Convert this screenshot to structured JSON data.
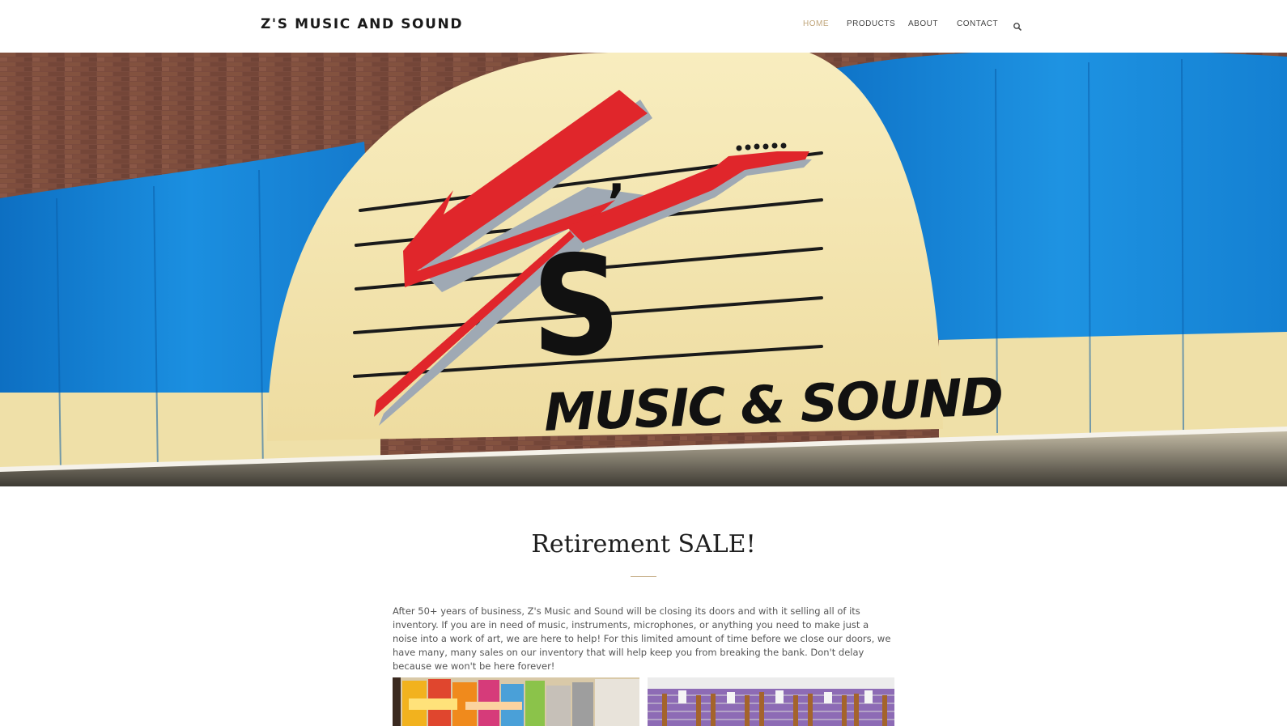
{
  "header": {
    "brand": "Z'S MUSIC AND SOUND",
    "nav": {
      "home": "HOME",
      "products": "PRODUCTS",
      "about": "ABOUT",
      "contact": "CONTACT"
    },
    "search_icon": "search-icon"
  },
  "hero": {
    "sign": {
      "apostrophe": "’",
      "s": "S",
      "subtitle": "MUSIC & SOUND"
    }
  },
  "main": {
    "title": "Retirement SALE!",
    "paragraph": "After 50+ years of business, Z's Music and Sound will be closing its doors and with it selling all of its inventory. If you are in need of music, instruments, microphones, or anything you need to make just a noise into a work of art, we are here to help! For this limited amount of time before we close our doors, we have many, many sales on our inventory that will help keep you from breaking the bank. Don't delay because we won't be here forever!"
  },
  "colors": {
    "accent": "#c0a57a",
    "awning_blue": "#1a8ad8",
    "sign_cream": "#f5e9b6",
    "logo_red": "#e0262b"
  }
}
